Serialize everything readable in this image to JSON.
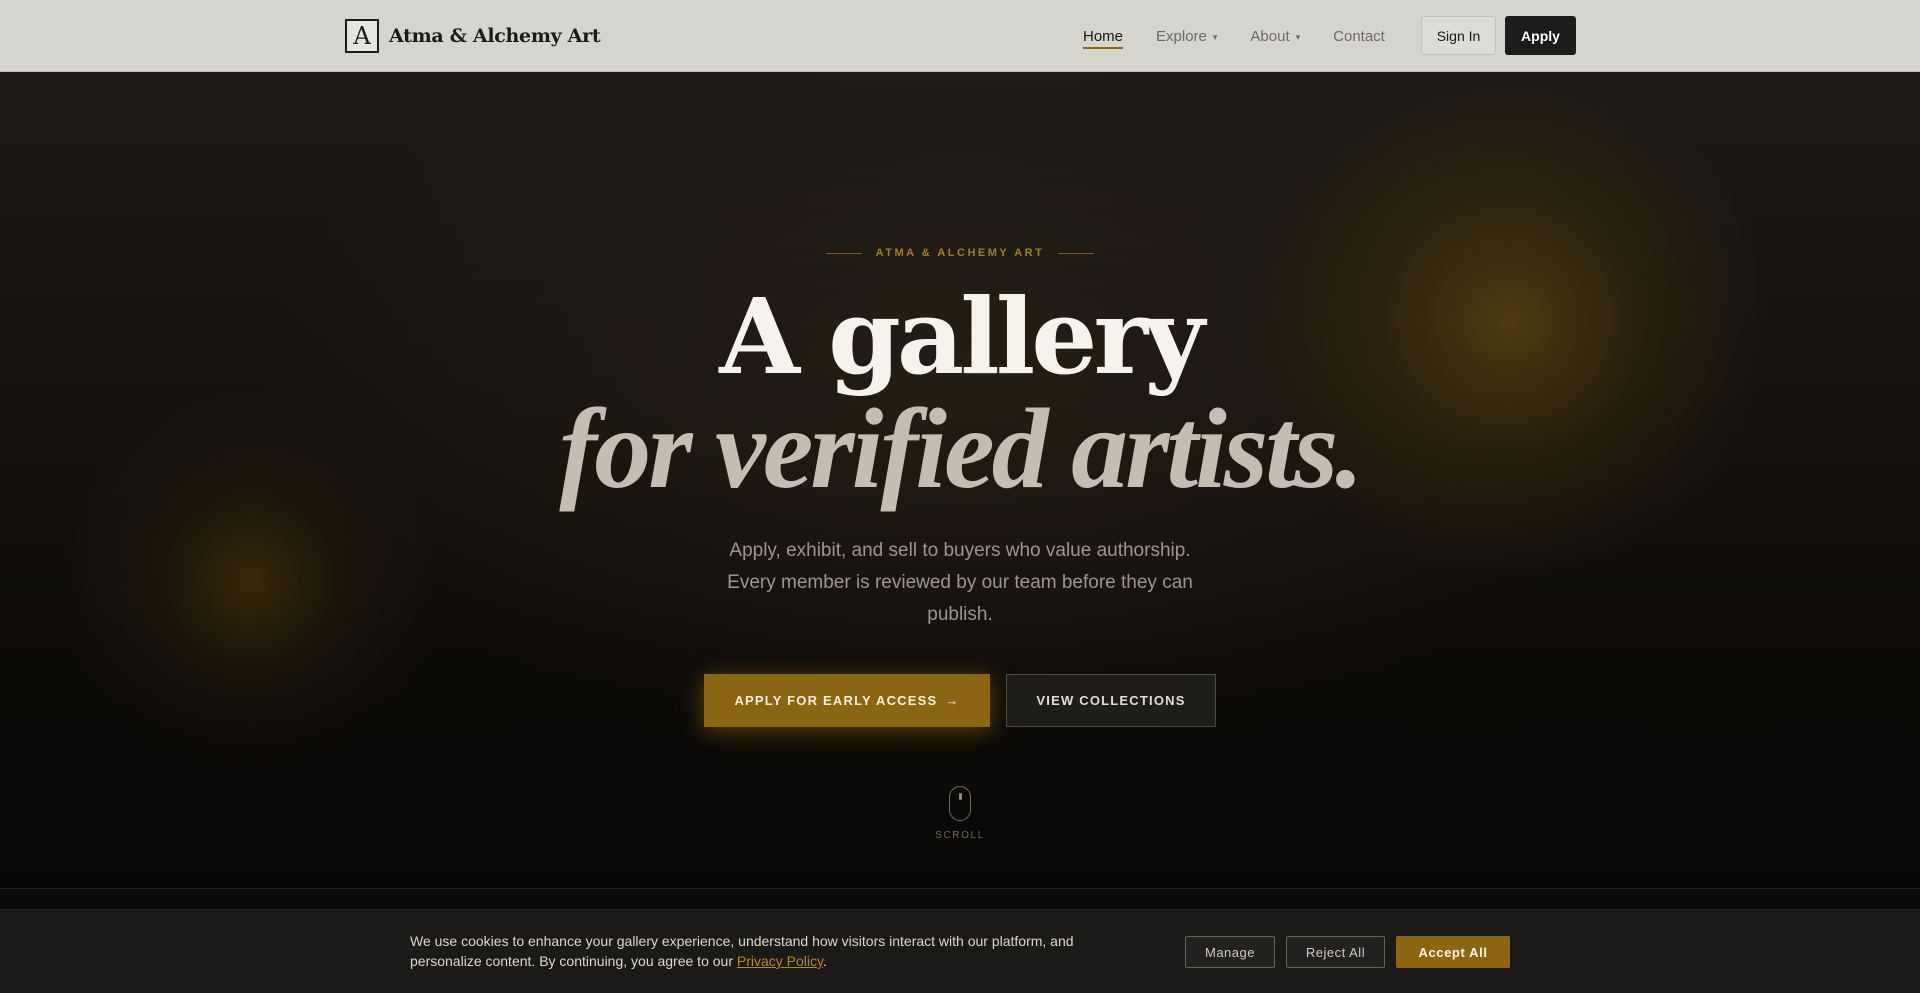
{
  "brand": {
    "logo_letter": "A",
    "name": "Atma & Alchemy Art"
  },
  "nav": {
    "items": [
      {
        "label": "Home",
        "active": true,
        "has_caret": false
      },
      {
        "label": "Explore",
        "active": false,
        "has_caret": true
      },
      {
        "label": "About",
        "active": false,
        "has_caret": true
      },
      {
        "label": "Contact",
        "active": false,
        "has_caret": false
      }
    ],
    "caret_glyph": "▾",
    "sign_in_label": "Sign In",
    "apply_label": "Apply"
  },
  "hero": {
    "eyebrow": "ATMA & ALCHEMY ART",
    "headline_line1": "A gallery",
    "headline_line2": "for verified artists.",
    "subtitle": "Apply, exhibit, and sell to buyers who value authorship. Every member is reviewed by our team before they can publish.",
    "cta_primary_label": "APPLY FOR EARLY ACCESS",
    "cta_primary_arrow": "→",
    "cta_secondary_label": "VIEW COLLECTIONS",
    "scroll_label": "SCROLL"
  },
  "cookie_banner": {
    "text": "We use cookies to enhance your gallery experience, understand how visitors interact with our platform, and personalize content. By continuing, you agree to our",
    "link_label": "Privacy Policy",
    "text_end": ".",
    "manage_label": "Manage",
    "reject_label": "Reject All",
    "accept_label": "Accept All"
  },
  "colors": {
    "accent": "#8b6514",
    "navbar_bg": "#d6d4cf",
    "hero_bg": "#120f0b",
    "banner_bg": "#1b1a18"
  }
}
